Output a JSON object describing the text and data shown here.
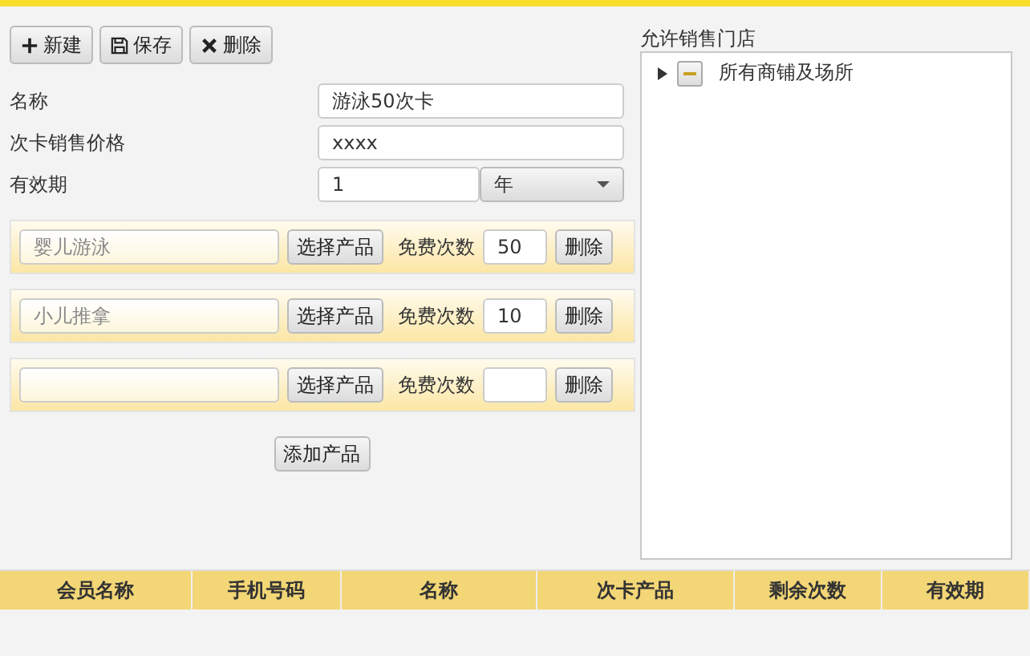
{
  "toolbar": [
    {
      "kind": "new",
      "label": "新建"
    },
    {
      "kind": "save",
      "label": "保存"
    },
    {
      "kind": "delete",
      "label": "删除"
    }
  ],
  "form": {
    "name_label": "名称",
    "name_value": "游泳50次卡",
    "price_label": "次卡销售价格",
    "price_value": "xxxx",
    "validity_label": "有效期",
    "validity_value": "1",
    "validity_unit": "年"
  },
  "products": [
    {
      "name": "婴儿游泳",
      "select_label": "选择产品",
      "count_label": "免费次数",
      "count": "50",
      "delete_label": "删除"
    },
    {
      "name": "小儿推拿",
      "select_label": "选择产品",
      "count_label": "免费次数",
      "count": "10",
      "delete_label": "删除"
    },
    {
      "select_label": "选择产品",
      "count_label": "免费次数",
      "delete_label": "删除"
    }
  ],
  "add_product": "添加产品",
  "stores": {
    "title": "允许销售门店",
    "tree": [
      {
        "label": "所有商铺及场所",
        "expanded": false,
        "indeterminate": true
      }
    ]
  },
  "table": {
    "columns": [
      "会员名称",
      "手机号码",
      "名称",
      "次卡产品",
      "剩余次数",
      "有效期"
    ]
  }
}
